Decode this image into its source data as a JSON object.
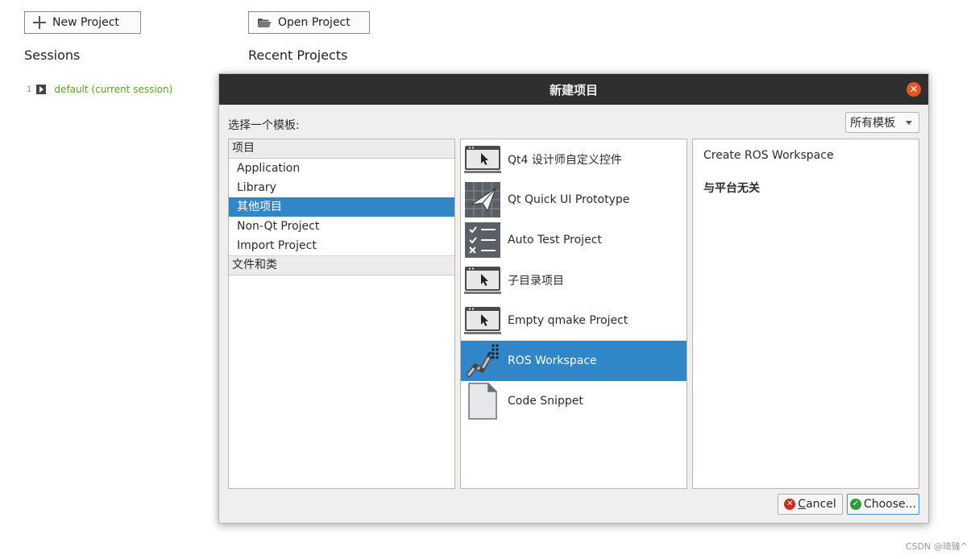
{
  "welcome": {
    "new_project_label": "New Project",
    "open_project_label": "Open Project",
    "sessions_title": "Sessions",
    "recent_title": "Recent Projects",
    "session": {
      "index": "1",
      "name": "default (current session)"
    }
  },
  "dialog": {
    "title": "新建项目",
    "choose_label": "选择一个模板:",
    "filter_value": "所有模板",
    "categories": [
      {
        "header": "项目",
        "items": [
          "Application",
          "Library",
          "其他项目",
          "Non-Qt Project",
          "Import Project"
        ]
      },
      {
        "header": "文件和类",
        "items": []
      }
    ],
    "selected_category": "其他项目",
    "templates": [
      {
        "label": "Qt4 设计师自定义控件",
        "icon": "monitor-cursor-icon"
      },
      {
        "label": "Qt Quick UI Prototype",
        "icon": "paper-plane-icon"
      },
      {
        "label": "Auto Test Project",
        "icon": "checklist-icon"
      },
      {
        "label": "子目录项目",
        "icon": "monitor-cursor-icon"
      },
      {
        "label": "Empty qmake Project",
        "icon": "monitor-cursor-icon"
      },
      {
        "label": "ROS Workspace",
        "icon": "robot-arm-icon"
      },
      {
        "label": "Code Snippet",
        "icon": "document-icon"
      }
    ],
    "selected_template": "ROS Workspace",
    "description": {
      "title": "Create ROS Workspace",
      "platform": "与平台无关"
    },
    "cancel_label": "Cancel",
    "choose_button_label": "Choose..."
  },
  "watermark": "CSDN @琦臻^",
  "colors": {
    "selection": "#3086c7",
    "title_bar": "#2f2f2f",
    "close": "#e95420",
    "session_link": "#5aa02c"
  }
}
